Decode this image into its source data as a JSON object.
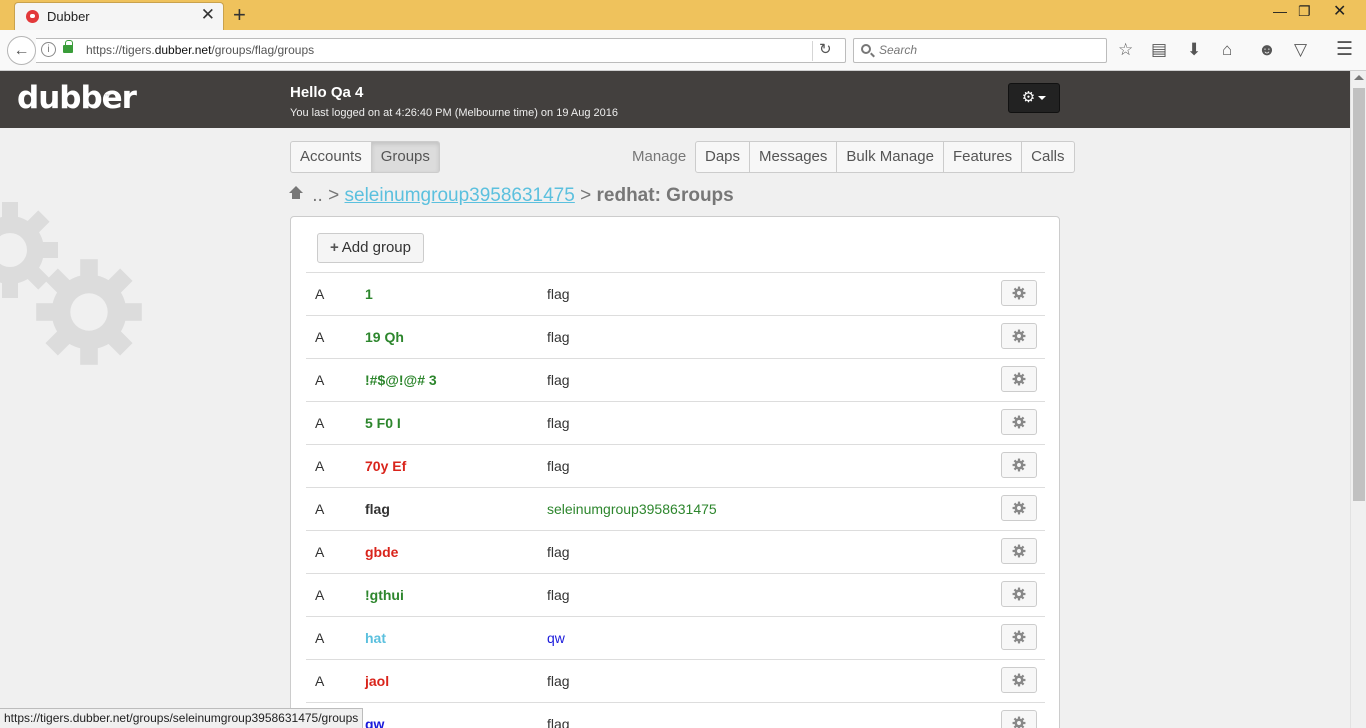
{
  "browser": {
    "tab_title": "Dubber",
    "tab_close": "✕",
    "new_tab": "+",
    "url_prefix": "https://tigers.",
    "url_host": "dubber.net",
    "url_path": "/groups/flag/groups",
    "search_placeholder": "Search",
    "status_url": "https://tigers.dubber.net/groups/seleinumgroup3958631475/groups"
  },
  "header": {
    "logo": "dubber",
    "logo_tm": "™",
    "greeting": "Hello Qa 4",
    "last_login": "You last logged on at 4:26:40 PM (Melbourne time) on 19 Aug 2016"
  },
  "nav": {
    "left_tabs": [
      {
        "label": "Accounts",
        "active": false
      },
      {
        "label": "Groups",
        "active": true
      }
    ],
    "manage_label": "Manage",
    "right_tabs": [
      "Daps",
      "Messages",
      "Bulk Manage",
      "Features",
      "Calls"
    ]
  },
  "breadcrumb": {
    "up": "..",
    "sep": ">",
    "link": "seleinumgroup3958631475",
    "current": "redhat: Groups"
  },
  "add_button_label": "Add group",
  "colors": {
    "green": "#2d862d",
    "red": "#d9241b",
    "dark": "#333333",
    "teal": "#5bc0de",
    "blue": "#1a1adb"
  },
  "groups": [
    {
      "letter": "A",
      "name": "1",
      "parent": "flag",
      "name_color": "#2d862d",
      "parent_color": "#333333"
    },
    {
      "letter": "A",
      "name": "19 Qh",
      "parent": "flag",
      "name_color": "#2d862d",
      "parent_color": "#333333"
    },
    {
      "letter": "A",
      "name": "!#$@!@# 3",
      "parent": "flag",
      "name_color": "#2d862d",
      "parent_color": "#333333"
    },
    {
      "letter": "A",
      "name": "5 F0 I",
      "parent": "flag",
      "name_color": "#2d862d",
      "parent_color": "#333333"
    },
    {
      "letter": "A",
      "name": "70y Ef",
      "parent": "flag",
      "name_color": "#d9241b",
      "parent_color": "#333333"
    },
    {
      "letter": "A",
      "name": "flag",
      "parent": "seleinumgroup3958631475",
      "name_color": "#333333",
      "parent_color": "#2d862d"
    },
    {
      "letter": "A",
      "name": "gbde",
      "parent": "flag",
      "name_color": "#d9241b",
      "parent_color": "#333333"
    },
    {
      "letter": "A",
      "name": "!gthui",
      "parent": "flag",
      "name_color": "#2d862d",
      "parent_color": "#333333"
    },
    {
      "letter": "A",
      "name": "hat",
      "parent": "qw",
      "name_color": "#5bc0de",
      "parent_color": "#1a1adb"
    },
    {
      "letter": "A",
      "name": "jaol",
      "parent": "flag",
      "name_color": "#d9241b",
      "parent_color": "#333333"
    },
    {
      "letter": "A",
      "name": "qw",
      "parent": "flag",
      "name_color": "#1a1adb",
      "parent_color": "#333333"
    }
  ]
}
